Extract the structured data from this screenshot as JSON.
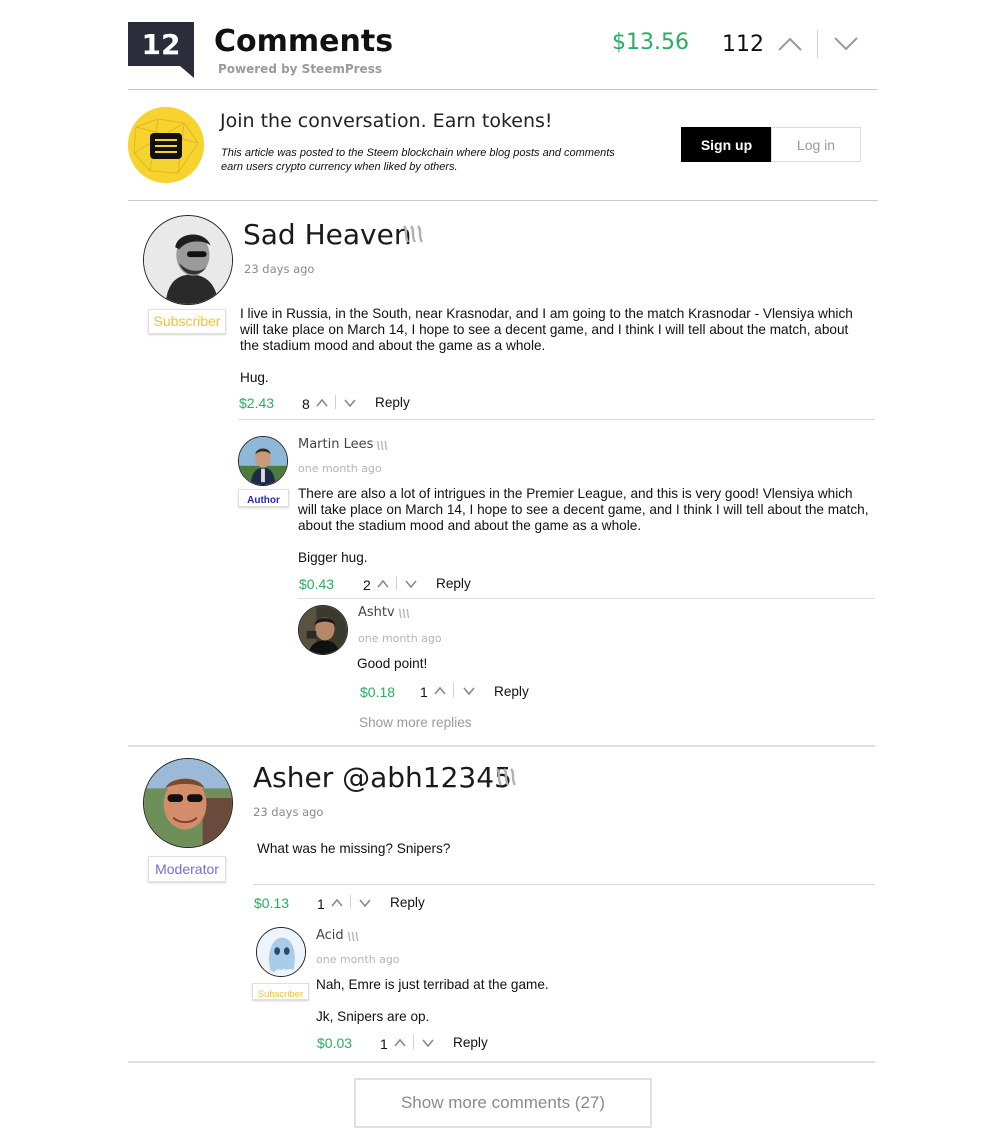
{
  "header": {
    "count": "12",
    "title": "Comments",
    "powered_by": "Powered by SteemPress",
    "payout": "$13.56",
    "votes": "112",
    "upvote_icon": "chevron-up-icon",
    "downvote_icon": "chevron-down-icon"
  },
  "join": {
    "logo_icon": "steem-menu-logo-icon",
    "title": "Join the conversation. Earn tokens!",
    "subtitle": "This article was posted to the Steem blockchain where blog posts and comments earn users crypto currency when liked by others.",
    "signup_label": "Sign up",
    "login_label": "Log in"
  },
  "comments": [
    {
      "author": "Sad Heaven",
      "time": "23 days ago",
      "badge": "Subscriber",
      "paragraphs": [
        "I live in Russia, in the South, near Krasnodar, and I am going to the match Krasnodar - Vlensiya which will take place on March 14, I hope to see a decent game, and I think I will tell about the match, about the stadium mood and about the game as a whole.",
        "Hug."
      ],
      "payout": "$2.43",
      "votes": "8",
      "reply_label": "Reply",
      "replies": [
        {
          "author": "Martin Lees",
          "time": "one month ago",
          "badge": "Author",
          "paragraphs": [
            "There are also a lot of intrigues in the Premier League, and this is very good! Vlensiya which will take place on March 14, I hope to see a decent game, and I think I will tell about the match, about the stadium mood and about the game as a whole.",
            "Bigger hug."
          ],
          "payout": "$0.43",
          "votes": "2",
          "reply_label": "Reply",
          "replies": [
            {
              "author": "Ashtv",
              "time": "one month ago",
              "paragraphs": [
                "Good point!"
              ],
              "payout": "$0.18",
              "votes": "1",
              "reply_label": "Reply"
            }
          ],
          "show_more_replies": "Show more replies"
        }
      ]
    },
    {
      "author": "Asher @abh12345",
      "time": "23 days ago",
      "badge": "Moderator",
      "paragraphs": [
        "What was he missing? Snipers?"
      ],
      "payout": "$0.13",
      "votes": "1",
      "reply_label": "Reply",
      "replies": [
        {
          "author": "Acid",
          "time": "one month ago",
          "badge": "Subscriber",
          "paragraphs": [
            "Nah, Emre is just terribad at the game.",
            "Jk, Snipers are op."
          ],
          "payout": "$0.03",
          "votes": "1",
          "reply_label": "Reply"
        }
      ]
    }
  ],
  "show_more_comments": "Show more comments (27)",
  "colors": {
    "payout_green": "#27ae60",
    "subscriber_badge": "#f2c233",
    "author_badge": "#2a2aa8",
    "moderator_badge": "#6f6fd8",
    "count_box": "#2b2e3a",
    "steem_logo_yellow": "#f7d330"
  }
}
